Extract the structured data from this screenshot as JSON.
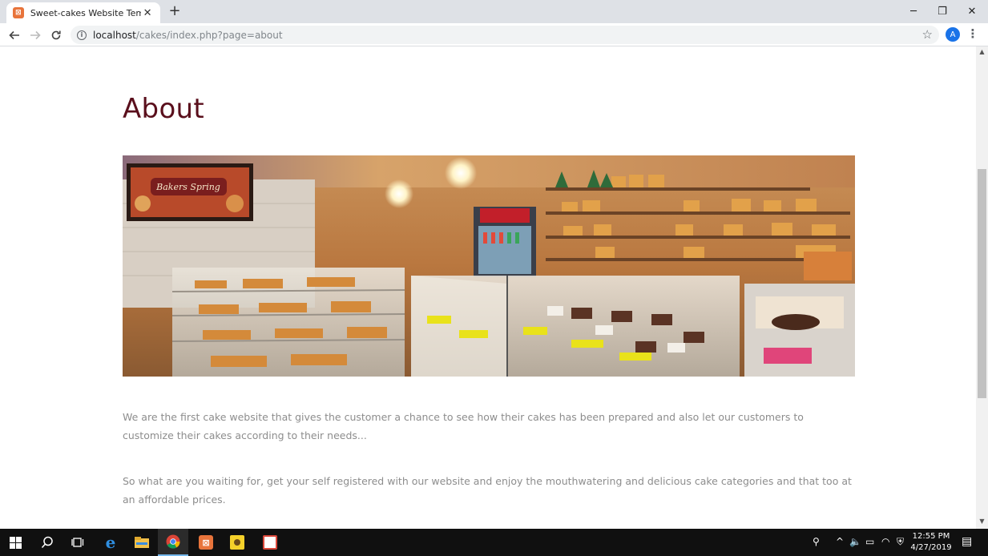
{
  "browser": {
    "tab_title": "Sweet-cakes Website Template |",
    "tab_close": "✕",
    "new_tab": "+",
    "url_host": "localhost",
    "url_path": "/cakes/index.php?page=about",
    "avatar_letter": "A",
    "window_controls": {
      "minimize": "─",
      "restore": "❐",
      "close": "✕"
    }
  },
  "page": {
    "title": "About",
    "paragraphs": [
      "We are the first cake website that gives the customer a chance to see how their cakes has been prepared and also let our customers to customize their cakes according to their needs...",
      "So what are you waiting for, get your self registered with our website and enjoy the mouthwatering and delicious cake categories and that too at an affordable prices."
    ],
    "hero_sign_text": "Bakers Spring"
  },
  "taskbar": {
    "time": "12:55 PM",
    "date": "4/27/2019"
  },
  "colors": {
    "title": "#5a0f1c",
    "body_text": "#8d8d8d",
    "accent_blue": "#1a73e8"
  }
}
